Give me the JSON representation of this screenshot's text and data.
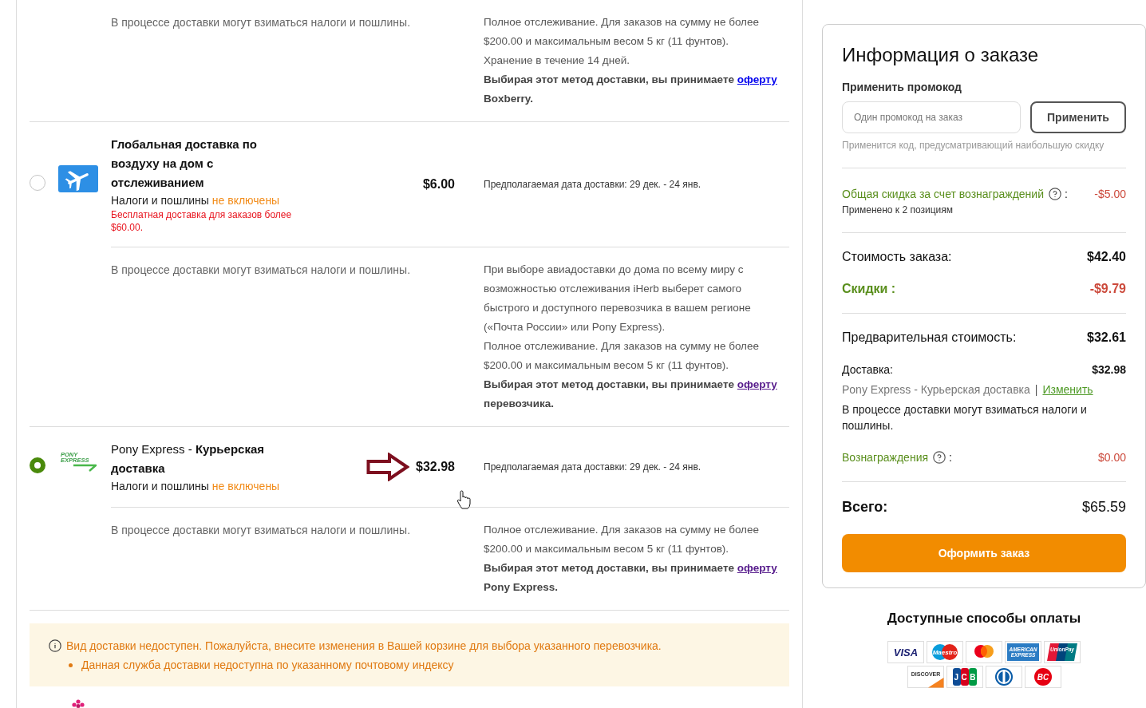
{
  "previous_option_details": {
    "note": "В процессе доставки могут взиматься налоги и пошлины.",
    "description": [
      "Полное отслеживание. Для заказов на сумму не более $200.00 и максимальным весом 5 кг (11 фунтов).",
      "Хранение в течение 14 дней."
    ],
    "offer": {
      "text": "Выбирая этот метод доставки, вы принимаете",
      "link": "оферту",
      "link_visited": false,
      "carrier": "Boxberry."
    }
  },
  "shipping_options": [
    {
      "selected": false,
      "logo": {
        "kind": "plane"
      },
      "title": "Глобальная доставка по воздуху на дом с отслеживанием",
      "taxes": {
        "text": "Налоги и пошлины",
        "status": "не включены"
      },
      "promo": "Бесплатная доставка для заказов более $60.00.",
      "arrow_marker": false,
      "price": "$6.00",
      "delivery_estimate": "Предполагаемая дата доставки: 29 дек. - 24 янв.",
      "details": {
        "note": "В процессе доставки могут взиматься налоги и пошлины.",
        "description": [
          "При выборе авиадоставки до дома по всему миру с возможностью отслеживания iHerb выберет самого быстрого и доступного перевозчика в вашем регионе («Почта России» или Pony Express).",
          "Полное отслеживание. Для заказов на сумму не более $200.00 и максимальным весом 5 кг (11 фунтов)."
        ],
        "offer": {
          "text": "Выбирая этот метод доставки, вы принимаете",
          "link": "оферту",
          "link_visited": true,
          "carrier": "перевозчика."
        }
      }
    },
    {
      "selected": true,
      "logo": {
        "kind": "wordmark",
        "text": "PONY EXPRESS"
      },
      "carrier": "Pony Express -",
      "title": "Курьерская доставка",
      "taxes": {
        "text": "Налоги и пошлины",
        "status": "не включены"
      },
      "arrow_marker": true,
      "price": "$32.98",
      "delivery_estimate": "Предполагаемая дата доставки: 29 дек. - 24 янв.",
      "details": {
        "note": "В процессе доставки могут взиматься налоги и пошлины.",
        "description": [
          "Полное отслеживание. Для заказов на сумму не более $200.00 и максимальным весом 5 кг (11 фунтов)."
        ],
        "offer": {
          "text": "Выбирая этот метод доставки, вы принимаете",
          "link": "оферту",
          "link_visited": true,
          "carrier": "Pony Express."
        }
      }
    }
  ],
  "alert": {
    "message": "Вид доставки недоступен. Пожалуйста, внесите изменения в Вашей корзине для выбора указанного перевозчика.",
    "items": [
      "Данная служба доставки недоступна по указанному почтовому индексу"
    ]
  },
  "order_summary": {
    "title": "Информация о заказе",
    "promo": {
      "label": "Применить промокод",
      "placeholder": "Один промокод на заказ",
      "button": "Применить",
      "hint": "Применится код, предусматривающий наибольшую скидку"
    },
    "rewards_discount": {
      "label": "Общая скидка за счет вознаграждений",
      "separator": ":",
      "amount": "-$5.00",
      "note": "Применено к 2 позициям"
    },
    "subtotal": {
      "label": "Стоимость заказа:",
      "amount": "$42.40"
    },
    "discounts": {
      "label": "Скидки :",
      "amount": "-$9.79"
    },
    "pre_total": {
      "label": "Предварительная стоимость:",
      "amount": "$32.61"
    },
    "shipping": {
      "label": "Доставка:",
      "amount": "$32.98",
      "method": "Pony Express - Курьерская доставка",
      "divider": "|",
      "change_link": "Изменить",
      "note": "В процессе доставки могут взиматься налоги и пошлины."
    },
    "rewards": {
      "label": "Вознаграждения",
      "separator": ":",
      "amount": "$0.00"
    },
    "total": {
      "label": "Всего:",
      "amount": "$65.59"
    },
    "checkout_button": "Оформить заказ"
  },
  "payment": {
    "title": "Доступные способы оплаты",
    "methods": [
      {
        "kind": "visa",
        "label": "VISA"
      },
      {
        "kind": "maestro",
        "label": "Maestro"
      },
      {
        "kind": "mastercard"
      },
      {
        "kind": "amex",
        "label": "AMERICAN EXPRESS"
      },
      {
        "kind": "unionpay",
        "label": "UnionPay"
      },
      {
        "kind": "discover",
        "label": "DISCOVER"
      },
      {
        "kind": "jcb",
        "label": "JCB"
      },
      {
        "kind": "diners"
      },
      {
        "kind": "bc",
        "label": "BC"
      }
    ]
  }
}
